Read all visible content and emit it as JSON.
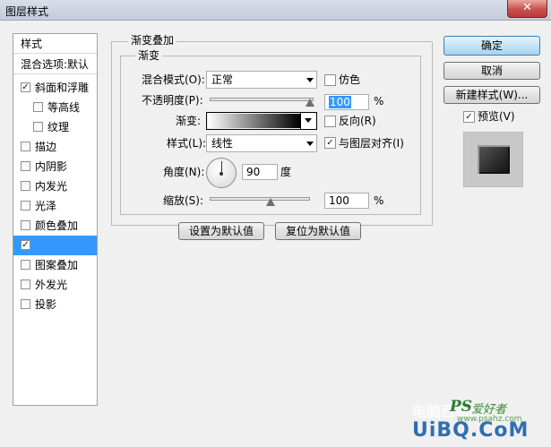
{
  "window": {
    "title": "图层样式",
    "close_glyph": "✕"
  },
  "style_list": {
    "header": "样式",
    "blend_options": "混合选项:默认",
    "items": [
      {
        "label": "斜面和浮雕",
        "checked": true,
        "indent": false,
        "selected": false
      },
      {
        "label": "等高线",
        "checked": false,
        "indent": true,
        "selected": false
      },
      {
        "label": "纹理",
        "checked": false,
        "indent": true,
        "selected": false
      },
      {
        "label": "描边",
        "checked": false,
        "indent": false,
        "selected": false
      },
      {
        "label": "内阴影",
        "checked": false,
        "indent": false,
        "selected": false
      },
      {
        "label": "内发光",
        "checked": false,
        "indent": false,
        "selected": false
      },
      {
        "label": "光泽",
        "checked": false,
        "indent": false,
        "selected": false
      },
      {
        "label": "颜色叠加",
        "checked": false,
        "indent": false,
        "selected": false
      },
      {
        "label": "",
        "checked": true,
        "indent": false,
        "selected": true
      },
      {
        "label": "图案叠加",
        "checked": false,
        "indent": false,
        "selected": false
      },
      {
        "label": "外发光",
        "checked": false,
        "indent": false,
        "selected": false
      },
      {
        "label": "投影",
        "checked": false,
        "indent": false,
        "selected": false
      }
    ]
  },
  "gradient_overlay": {
    "group_title": "渐变叠加",
    "sub_group_title": "渐变",
    "blend_mode_label": "混合模式(O):",
    "blend_mode_value": "正常",
    "dither_label": "仿色",
    "dither_checked": false,
    "opacity_label": "不透明度(P):",
    "opacity_value": "100",
    "opacity_unit": "%",
    "opacity_level": 1.0,
    "gradient_label": "渐变:",
    "gradient_stops": [
      "#ffffff",
      "#000000"
    ],
    "reverse_label": "反向(R)",
    "reverse_checked": false,
    "style_label": "样式(L):",
    "style_value": "线性",
    "align_label": "与图层对齐(I)",
    "align_checked": true,
    "angle_label": "角度(N):",
    "angle_value": "90",
    "angle_unit": "度",
    "scale_label": "缩放(S):",
    "scale_value": "100",
    "scale_unit": "%",
    "scale_level": 0.5,
    "make_default_label": "设置为默认值",
    "reset_default_label": "复位为默认值"
  },
  "buttons": {
    "ok": "确定",
    "cancel": "取消",
    "new_style": "新建样式(W)...",
    "preview_label": "预览(V)",
    "preview_checked": true
  },
  "watermark": {
    "site": "电脑百事网",
    "ps_logo": "PS",
    "ps_text": "爱好者",
    "url": "www.psahz.com",
    "uibq": "UiBQ.CoM"
  }
}
